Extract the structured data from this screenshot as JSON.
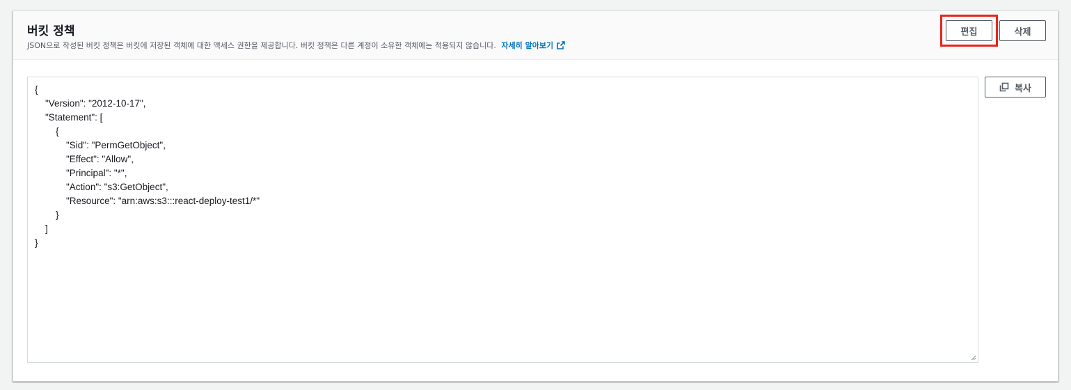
{
  "header": {
    "title": "버킷 정책",
    "description": "JSON으로 작성된 버킷 정책은 버킷에 저장된 객체에 대한 액세스 권한을 제공합니다. 버킷 정책은 다른 계정이 소유한 객체에는 적용되지 않습니다.",
    "learn_more": "자세히 알아보기",
    "learn_more_icon": "external-link-icon"
  },
  "actions": {
    "edit_label": "편집",
    "delete_label": "삭제",
    "copy_label": "복사",
    "copy_icon": "copy-icon"
  },
  "policy": {
    "json_text": "{\n    \"Version\": \"2012-10-17\",\n    \"Statement\": [\n        {\n            \"Sid\": \"PermGetObject\",\n            \"Effect\": \"Allow\",\n            \"Principal\": \"*\",\n            \"Action\": \"s3:GetObject\",\n            \"Resource\": \"arn:aws:s3:::react-deploy-test1/*\"\n        }\n    ]\n}"
  },
  "colors": {
    "link": "#0073bb",
    "highlight_border": "#e8241b",
    "text": "#16191f",
    "secondary_text": "#545b64"
  }
}
